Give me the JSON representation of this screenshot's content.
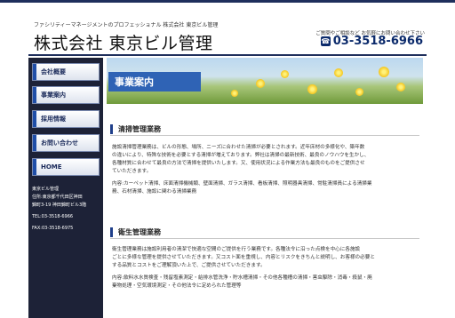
{
  "header": {
    "tagline": "ファシリティーマネージメントのプロフェッショナル 株式会社 東京ビル管理",
    "title": "株式会社 東京ビル管理",
    "contact_note": "ご質問やご相談など お気軽にお問い合わせ下さい",
    "phone": "03-3518-6966"
  },
  "sidebar": {
    "items": [
      {
        "label": "会社概要"
      },
      {
        "label": "事業案内"
      },
      {
        "label": "採用情報"
      },
      {
        "label": "お問い合わせ"
      },
      {
        "label": "HOME"
      }
    ],
    "company": {
      "name": "東京ビル管理",
      "address1": "住所:東京都千代田区神田",
      "address2": "錦町3-19 神田錦町ビル3階",
      "tel": "TEL:03-3518-6966",
      "fax": "FAX:03-3518-6975"
    }
  },
  "hero": {
    "label": "事業案内"
  },
  "sections": [
    {
      "heading": "清掃管理業務",
      "lines": [
        "施設清掃管理業務は、ビルの形態、場所、ニーズに合わせた清掃が必要とされます。近年床材の多様化や、築年数",
        "の違いにより、特殊な技術を必要とする清掃が増えております。弊社は清掃の最新技術、最良のノウハウを生かし、",
        "各種材質に合わせて最良の方法で清掃を提供いたします。又、使用状況による作業方法も最良のものをご提供させ",
        "ていただきます。",
        "",
        "内容:カーペット清掃、床面清掃機械類、壁面清掃、ガラス清掃、看板清掃、照明器具清掃、常駐清掃員による清掃業",
        "務、石材清掃、施設に関わる清掃業務"
      ]
    },
    {
      "heading": "衛生管理業務",
      "lines": [
        "衛生管理業務は施設利用者の清潔で快適な空間のご提供を行う業務です。各種法令に沿った点検を中心に各施設",
        "ごとに多様な管理を提供させていただきます。又コスト面を重視し、内容とリスクをきちんと説明し、お客様の必要と",
        "する品質とコストをご理解頂いた上で、ご提供させていただきます。",
        "",
        "内容:飲料水水質検査・残留塩素測定・給排水管洗浄・貯水槽清掃・その他各種槽の清掃・害虫駆除・消毒・殺鼠・廃",
        "棄物処理・空気環境測定・その他法令に定められた管理等"
      ]
    }
  ],
  "colors": {
    "nav_dark": "#1d2237",
    "accent_blue": "#2f63b5",
    "phone_blue": "#0b2a6b"
  }
}
